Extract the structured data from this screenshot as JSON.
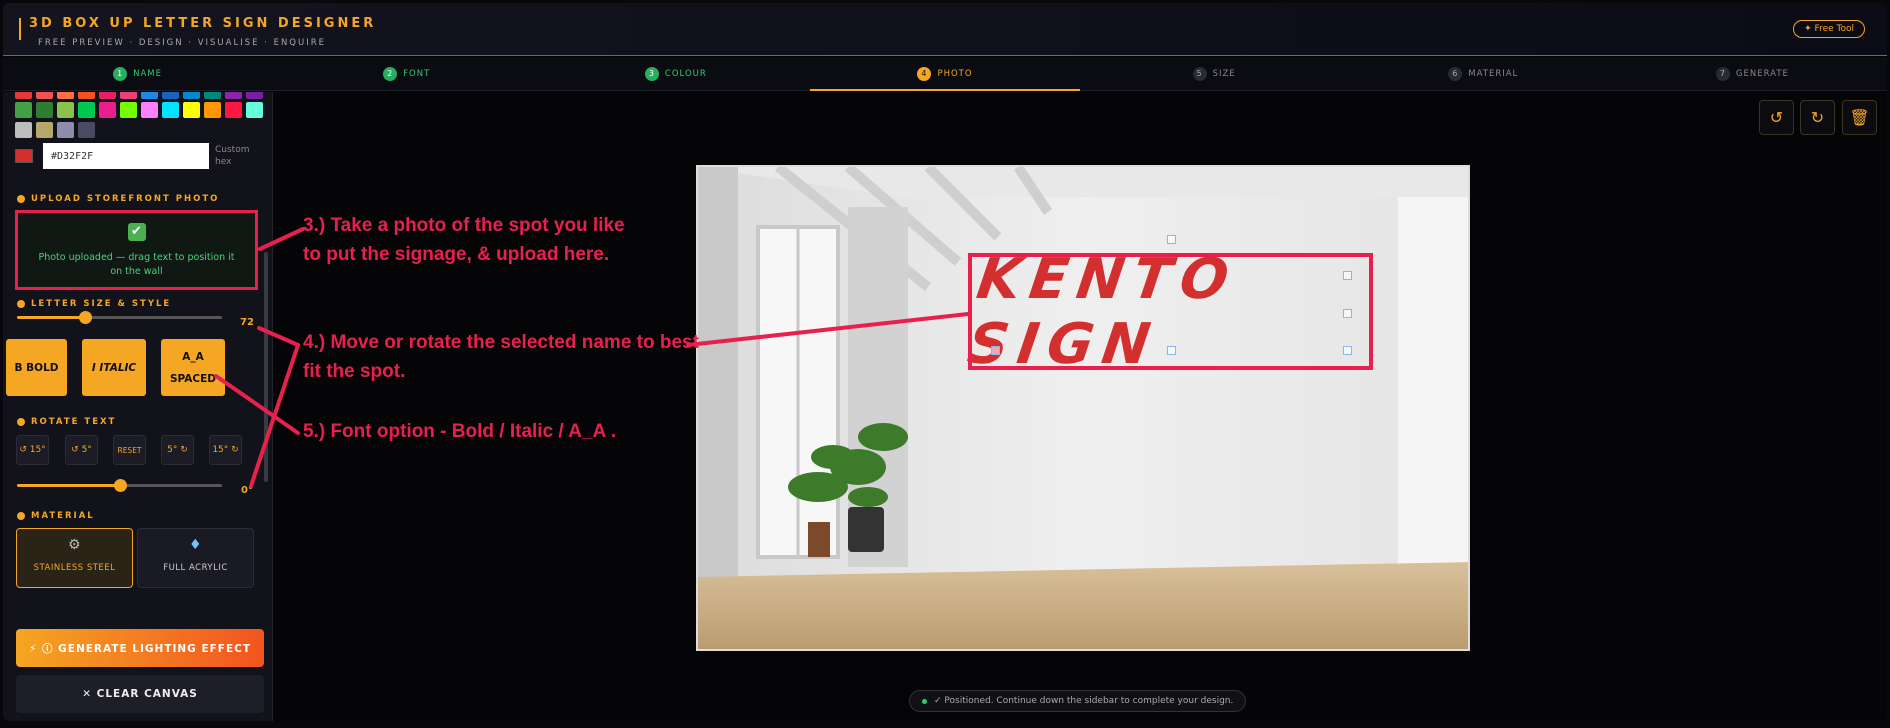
{
  "header": {
    "title": "3D BOX UP LETTER SIGN DESIGNER",
    "subtitle": "FREE PREVIEW · DESIGN · VISUALISE · ENQUIRE",
    "badge": "✦ Free Tool"
  },
  "steps": [
    {
      "num": "1",
      "label": "NAME",
      "state": "done"
    },
    {
      "num": "2",
      "label": "FONT",
      "state": "done"
    },
    {
      "num": "3",
      "label": "COLOUR",
      "state": "done"
    },
    {
      "num": "4",
      "label": "PHOTO",
      "state": "active"
    },
    {
      "num": "5",
      "label": "SIZE",
      "state": "pending"
    },
    {
      "num": "6",
      "label": "MATERIAL",
      "state": "pending"
    },
    {
      "num": "7",
      "label": "GENERATE",
      "state": "pending"
    }
  ],
  "colour": {
    "swatch_rows": [
      [
        "#e53935",
        "#ef5350",
        "#ff7043",
        "#f4511e",
        "#e91e63",
        "#ec407a",
        "#1e88e5",
        "#1565c0",
        "#0288d1",
        "#00897b",
        "#8e24aa",
        "#7b1fa2"
      ],
      [
        "#43a047",
        "#2e7d32",
        "#8bc34a",
        "#00c853",
        "#e91e8c",
        "#76ff03",
        "#ff80ff",
        "#00e5ff",
        "#ffff00",
        "#ff9800",
        "#ff1744",
        "#64ffda"
      ],
      [
        "#bdbdbd",
        "#b5a86a",
        "#8e8ea8",
        "#4a4a60"
      ]
    ],
    "hex_value": "#D32F2F",
    "hex_chip_color": "#d32f2f",
    "custom_label": "Custom hex"
  },
  "upload": {
    "heading": "UPLOAD STOREFRONT PHOTO",
    "status": "Photo uploaded — drag text to position it on the wall"
  },
  "letter_size": {
    "heading": "LETTER SIZE & STYLE",
    "value": "72",
    "fraction": 0.33
  },
  "font_options": {
    "bold": "B BOLD",
    "italic": "I ITALIC",
    "spaced_top": "A_A",
    "spaced_bottom": "SPACED"
  },
  "rotate": {
    "heading": "ROTATE TEXT",
    "buttons": [
      "↺ 15°",
      "↺ 5°",
      "RESET",
      "5° ↻",
      "15° ↻"
    ],
    "value": "0°",
    "fraction": 0.5
  },
  "material": {
    "heading": "MATERIAL",
    "options": [
      {
        "label": "STAINLESS STEEL",
        "icon": "gear-icon",
        "selected": true
      },
      {
        "label": "FULL ACRYLIC",
        "icon": "gem-icon",
        "selected": false
      }
    ]
  },
  "actions": {
    "generate": "⚡ ⓘ GENERATE LIGHTING EFFECT",
    "clear": "✕ CLEAR CANVAS"
  },
  "canvas": {
    "sign_text": "KENTO SIGN",
    "sign_color": "#d32f2f",
    "status": "✓ Positioned. Continue down the sidebar to complete your design."
  },
  "annotations": {
    "a3": "3.) Take a photo of the spot you like to put the signage, & upload here.",
    "a4": "4.) Move or rotate the selected name to best fit the spot.",
    "a5": "5.) Font option - Bold / Italic / A_A ."
  },
  "colors": {
    "accent": "#f5a623",
    "done": "#27ae60",
    "annotation": "#e8204e"
  }
}
